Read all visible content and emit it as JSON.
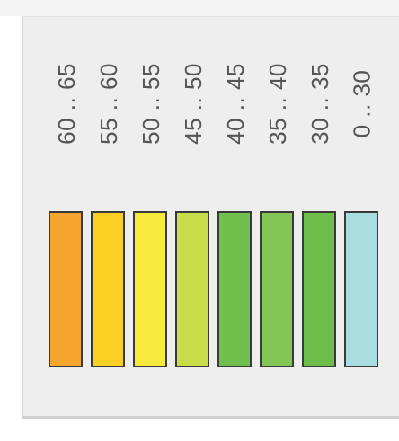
{
  "legend": {
    "items": [
      {
        "label": "60 .. 65",
        "color": "#f6a52f"
      },
      {
        "label": "55 .. 60",
        "color": "#fbd024"
      },
      {
        "label": "50 .. 55",
        "color": "#f7ea3c"
      },
      {
        "label": "45 .. 50",
        "color": "#c7dd4a"
      },
      {
        "label": "40 .. 45",
        "color": "#71bf4c"
      },
      {
        "label": "35 .. 40",
        "color": "#82c655"
      },
      {
        "label": "30 .. 35",
        "color": "#6dbd4b"
      },
      {
        "label": "0 .. 30",
        "color": "#a9dde0"
      }
    ]
  }
}
